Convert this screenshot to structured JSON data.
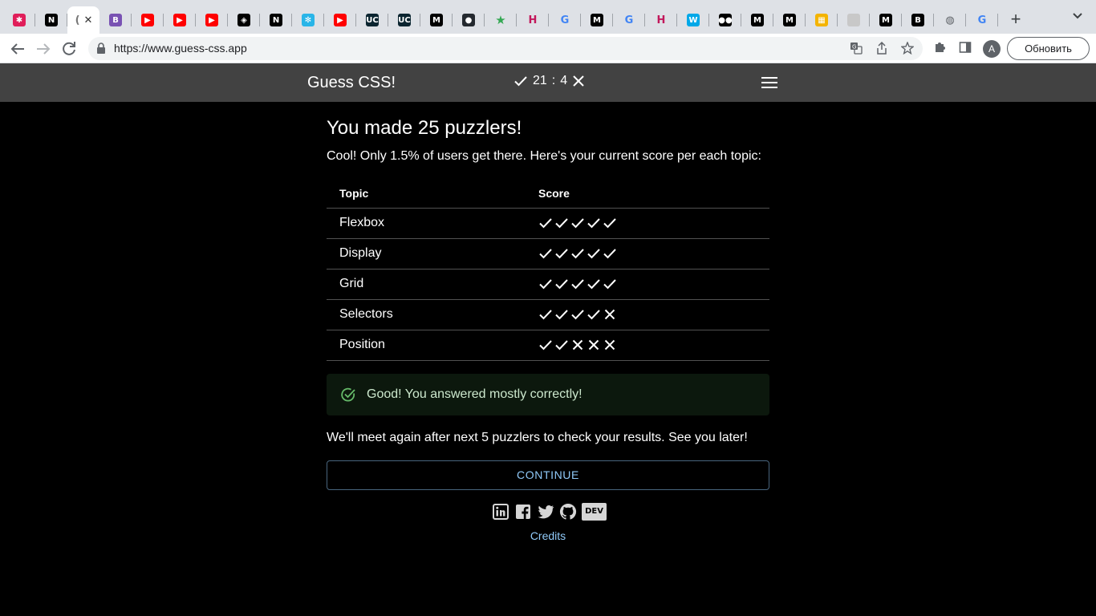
{
  "browser": {
    "tabs": [
      {
        "icon": "slack-icon",
        "color": "#e01e5a",
        "glyph": "✱"
      },
      {
        "icon": "notion-icon",
        "color": "#000000",
        "glyph": "N"
      },
      {
        "icon": "guess-css-icon",
        "color": "#777777",
        "glyph": "(",
        "active": true
      },
      {
        "icon": "bootstrap-icon",
        "color": "#7952b3",
        "glyph": "B"
      },
      {
        "icon": "youtube-icon",
        "color": "#ff0000",
        "glyph": "▶"
      },
      {
        "icon": "youtube-icon",
        "color": "#ff0000",
        "glyph": "▶"
      },
      {
        "icon": "youtube-icon",
        "color": "#ff0000",
        "glyph": "▶"
      },
      {
        "icon": "codepen-icon",
        "color": "#000000",
        "glyph": "◈"
      },
      {
        "icon": "notion-icon",
        "color": "#000000",
        "glyph": "N"
      },
      {
        "icon": "snowflake-icon",
        "color": "#29b5e8",
        "glyph": "✻"
      },
      {
        "icon": "youtube-icon",
        "color": "#ff0000",
        "glyph": "▶"
      },
      {
        "icon": "uc-icon",
        "color": "#0b2530",
        "glyph": "UC"
      },
      {
        "icon": "uc-icon",
        "color": "#0b2530",
        "glyph": "UC"
      },
      {
        "icon": "medium-icon",
        "color": "#000000",
        "glyph": "M"
      },
      {
        "icon": "github-icon",
        "color": "#24292f",
        "glyph": "●"
      },
      {
        "icon": "star-icon",
        "color": "#34a853",
        "glyph": "★"
      },
      {
        "icon": "h-icon",
        "color": "#c2185b",
        "glyph": "H"
      },
      {
        "icon": "google-icon",
        "color": "#4285f4",
        "glyph": "G"
      },
      {
        "icon": "medium-icon",
        "color": "#000000",
        "glyph": "M"
      },
      {
        "icon": "google-icon",
        "color": "#4285f4",
        "glyph": "G"
      },
      {
        "icon": "h-icon",
        "color": "#c2185b",
        "glyph": "H"
      },
      {
        "icon": "w-icon",
        "color": "#00a8e8",
        "glyph": "W"
      },
      {
        "icon": "medium-dots-icon",
        "color": "#000000",
        "glyph": "●●"
      },
      {
        "icon": "medium-icon",
        "color": "#000000",
        "glyph": "M"
      },
      {
        "icon": "medium-icon",
        "color": "#000000",
        "glyph": "M"
      },
      {
        "icon": "colorful-squares-icon",
        "color": "#f4b400",
        "glyph": "▦"
      },
      {
        "icon": "blank-page-icon",
        "color": "#c8c8c8",
        "glyph": ""
      },
      {
        "icon": "medium-icon",
        "color": "#000000",
        "glyph": "M"
      },
      {
        "icon": "bs-icon",
        "color": "#000000",
        "glyph": "B"
      },
      {
        "icon": "globe-icon",
        "color": "#5f6368",
        "glyph": "◍"
      },
      {
        "icon": "google-icon",
        "color": "#4285f4",
        "glyph": "G"
      }
    ],
    "url": "https://www.guess-css.app",
    "avatar_letter": "A",
    "update_label": "Обновить"
  },
  "app": {
    "title": "Guess CSS!",
    "correct_count": "21",
    "score_separator": ":",
    "wrong_count": "4"
  },
  "main": {
    "heading": "You made 25 puzzlers!",
    "lead": "Cool! Only 1.5% of users get there. Here's your current score per each topic:",
    "table": {
      "headers": [
        "Topic",
        "Score"
      ],
      "rows": [
        {
          "topic": "Flexbox",
          "marks": [
            true,
            true,
            true,
            true,
            true
          ]
        },
        {
          "topic": "Display",
          "marks": [
            true,
            true,
            true,
            true,
            true
          ]
        },
        {
          "topic": "Grid",
          "marks": [
            true,
            true,
            true,
            true,
            true
          ]
        },
        {
          "topic": "Selectors",
          "marks": [
            true,
            true,
            true,
            true,
            false
          ]
        },
        {
          "topic": "Position",
          "marks": [
            true,
            true,
            false,
            false,
            false
          ]
        }
      ]
    },
    "alert": "Good! You answered mostly correctly!",
    "see_you": "We'll meet again after next 5 puzzlers to check your results. See you later!",
    "continue_label": "CONTINUE",
    "socials": [
      "linkedin-icon",
      "facebook-icon",
      "twitter-icon",
      "github-icon",
      "dev-icon"
    ],
    "dev_label": "DEV",
    "credits": "Credits"
  }
}
